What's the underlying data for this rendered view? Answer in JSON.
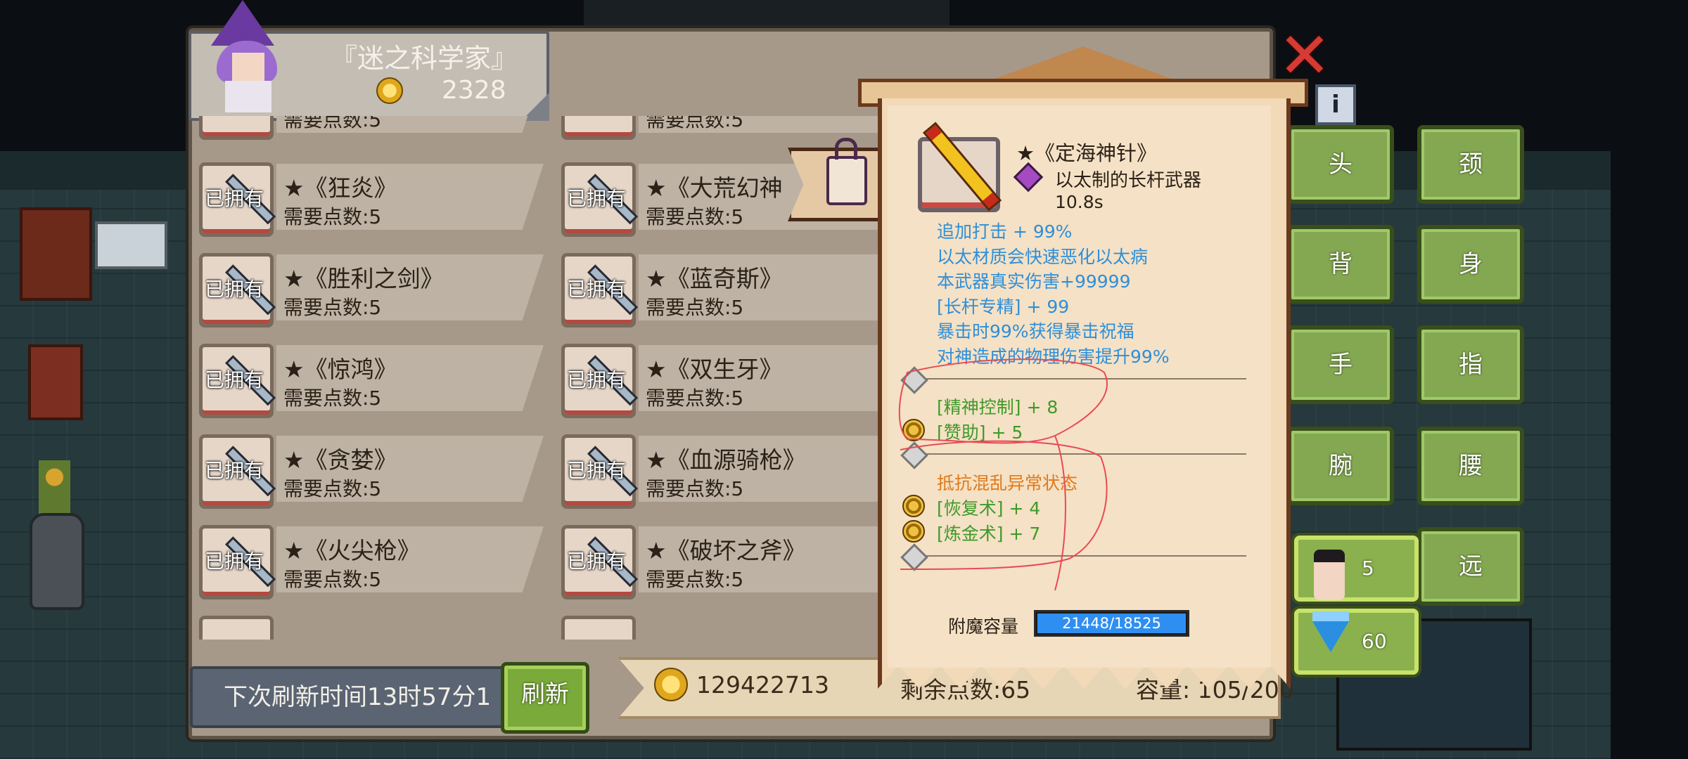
{
  "header": {
    "title": "『迷之科学家』",
    "gold": "2328"
  },
  "items": [
    {
      "name": "",
      "req": "需要点数:5"
    },
    {
      "name": "",
      "req": "需要点数:5"
    },
    {
      "name": "★《狂炎》",
      "req": "需要点数:5",
      "owned": "已拥有"
    },
    {
      "name": "★《大荒幻神",
      "req": "需要点数:5",
      "owned": "已拥有"
    },
    {
      "name": "★《胜利之剑》",
      "req": "需要点数:5",
      "owned": "已拥有"
    },
    {
      "name": "★《蓝奇斯》",
      "req": "需要点数:5",
      "owned": "已拥有"
    },
    {
      "name": "★《惊鸿》",
      "req": "需要点数:5",
      "owned": "已拥有"
    },
    {
      "name": "★《双生牙》",
      "req": "需要点数:5",
      "owned": "已拥有"
    },
    {
      "name": "★《贪婪》",
      "req": "需要点数:5",
      "owned": "已拥有"
    },
    {
      "name": "★《血源骑枪》",
      "req": "需要点数:5",
      "owned": "已拥有"
    },
    {
      "name": "★《火尖枪》",
      "req": "需要点数:5",
      "owned": "已拥有"
    },
    {
      "name": "★《破坏之斧》",
      "req": "需要点数:5",
      "owned": "已拥有"
    }
  ],
  "bottom": {
    "timer": "下次刷新时间13时57分1",
    "refresh_label": "刷新",
    "total_gold": "129422713",
    "points": "剩余点数:65",
    "capacity": "容量: 105/200"
  },
  "tooltip": {
    "name": "★《定海神针》",
    "type": "以太制的长杆武器",
    "speed": "10.8s",
    "blue_stats": [
      "追加打击 + 99%",
      "以太材质会快速恶化以太病",
      "本武器真实伤害+99999",
      "[长杆专精] + 99",
      "暴击时99%获得暴击祝福",
      "对神造成的物理伤害提升99%"
    ],
    "green_stats_1": [
      "[精神控制] + 8",
      "[赞助] + 5"
    ],
    "orange_stat": "抵抗混乱异常状态",
    "green_stats_2": [
      "[恢复术] + 4",
      "[炼金术] + 7"
    ],
    "capacity_label": "附魔容量",
    "capacity_value": "21448/18525",
    "capacity_ratio": 1.0
  },
  "equipment": {
    "head": "头",
    "neck": "颈",
    "back": "背",
    "body": "身",
    "hand": "手",
    "finger": "指",
    "wrist": "腕",
    "waist": "腰",
    "ranged": "远"
  },
  "stats": {
    "characters": "5",
    "gems": "60"
  },
  "colors": {
    "accent_green": "#84a852",
    "tooltip_blue": "#2f8fd8",
    "tooltip_green": "#3f9a2a",
    "tooltip_orange": "#e07a1a",
    "close_red": "#d63a32"
  },
  "icons": {
    "close": "close-icon",
    "info": "info-icon",
    "lock": "unlock-icon",
    "coin": "coin-icon",
    "gem": "gem-icon"
  }
}
